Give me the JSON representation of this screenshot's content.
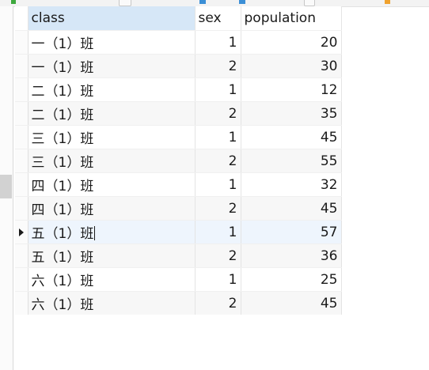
{
  "grid": {
    "columns": [
      {
        "key": "class",
        "label": "class",
        "align": "left"
      },
      {
        "key": "sex",
        "label": "sex",
        "align": "right"
      },
      {
        "key": "population",
        "label": "population",
        "align": "right"
      }
    ],
    "rows": [
      {
        "class": "一（1）班",
        "sex": "1",
        "population": "20"
      },
      {
        "class": "一（1）班",
        "sex": "2",
        "population": "30"
      },
      {
        "class": "二（1）班",
        "sex": "1",
        "population": "12"
      },
      {
        "class": "二（1）班",
        "sex": "2",
        "population": "35"
      },
      {
        "class": "三（1）班",
        "sex": "1",
        "population": "45"
      },
      {
        "class": "三（1）班",
        "sex": "2",
        "population": "55"
      },
      {
        "class": "四（1）班",
        "sex": "1",
        "population": "32"
      },
      {
        "class": "四（1）班",
        "sex": "2",
        "population": "45"
      },
      {
        "class": "五（1）班",
        "sex": "1",
        "population": "57"
      },
      {
        "class": "五（1）班",
        "sex": "2",
        "population": "36"
      },
      {
        "class": "六（1）班",
        "sex": "1",
        "population": "25"
      },
      {
        "class": "六（1）班",
        "sex": "2",
        "population": "45"
      }
    ],
    "current_row_index": 8,
    "current_row_icon": "row-pointer-arrow-icon",
    "selected_column_header": "class",
    "colors": {
      "header_selected": "#d6e7f7",
      "row_alternate": "#f7f7f7",
      "row_highlight": "#eef5fd",
      "grid_line": "#e4e4e4"
    }
  }
}
